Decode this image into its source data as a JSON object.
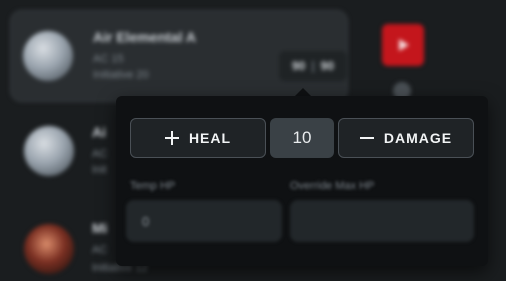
{
  "card": {
    "name": "Air Elemental A",
    "ac_label": "AC 15",
    "initiative_label": "Initiative 20",
    "hp_current": "90",
    "hp_max": "90"
  },
  "rows": [
    {
      "name": "Ai",
      "meta1": "AC",
      "meta2": "Init"
    },
    {
      "name": "Mi",
      "meta1": "AC",
      "meta2": "Initiative 12"
    }
  ],
  "popover": {
    "heal_label": "HEAL",
    "damage_label": "DAMAGE",
    "amount_value": "10",
    "temp_hp_label": "Temp HP",
    "temp_hp_value": "0",
    "override_max_hp_label": "Override Max HP",
    "override_max_hp_value": ""
  },
  "icons": {
    "heal": "plus-icon",
    "damage": "minus-icon",
    "side_action": "play-icon"
  },
  "colors": {
    "accent_red": "#c4161c",
    "background": "#1a1d1f",
    "popover_bg": "#0f1113"
  }
}
